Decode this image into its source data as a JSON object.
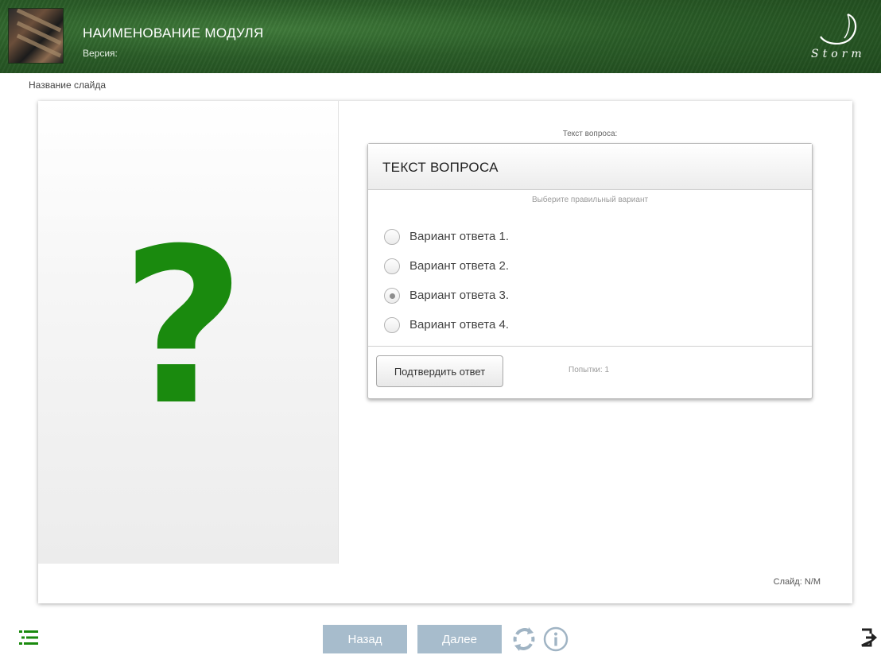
{
  "header": {
    "module_title": "НАИМЕНОВАНИЕ МОДУЛЯ",
    "version_label": "Версия:",
    "logo_text": "Storm"
  },
  "slide": {
    "name": "Название слайда",
    "counter": "Слайд: N/M"
  },
  "question": {
    "caption": "Текст вопроса:",
    "title": "ТЕКСТ ВОПРОСА",
    "hint": "Выберите правильный вариант",
    "options": [
      {
        "label": "Вариант ответа 1.",
        "selected": false
      },
      {
        "label": "Вариант ответа 2.",
        "selected": false
      },
      {
        "label": "Вариант ответа 3.",
        "selected": true
      },
      {
        "label": "Вариант ответа 4.",
        "selected": false
      }
    ],
    "confirm_label": "Подтвердить ответ",
    "attempts": "Попытки: 1"
  },
  "illustration": {
    "glyph": "?"
  },
  "toolbar": {
    "back_label": "Назад",
    "next_label": "Далее"
  },
  "colors": {
    "header_green": "#2a5c27",
    "question_mark": "#1a8a0e",
    "nav_button": "#a7bccc",
    "icon": "#a0b4c4",
    "exit_icon": "#222222"
  },
  "icons": [
    "menu-list-icon",
    "reload-icon",
    "info-icon",
    "exit-icon",
    "storm-logo"
  ]
}
